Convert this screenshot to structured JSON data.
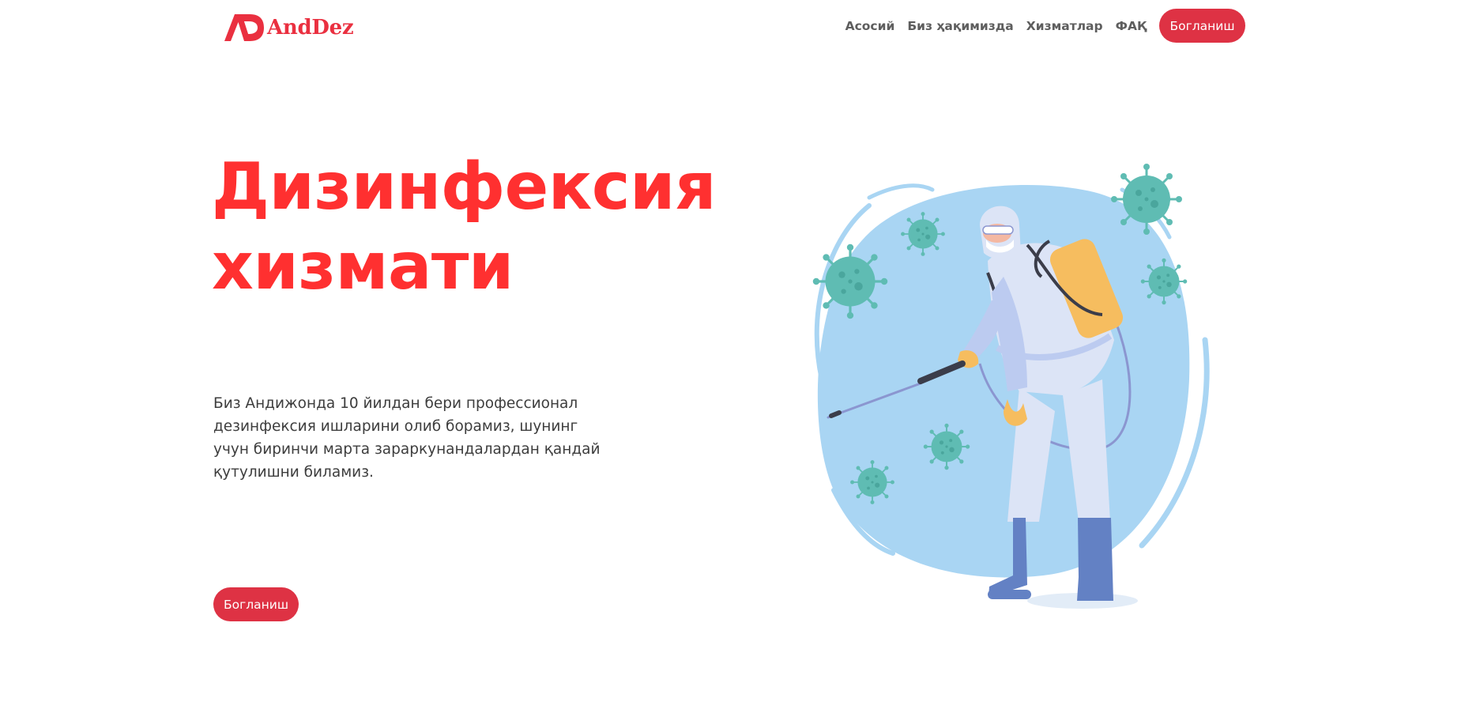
{
  "header": {
    "logo_text": "AndDez",
    "nav": [
      {
        "label": "Асосий"
      },
      {
        "label": "Биз ҳақимизда"
      },
      {
        "label": "Хизматлар"
      },
      {
        "label": "ФАҚ"
      }
    ],
    "cta_label": "Богланиш"
  },
  "hero": {
    "title_line1": "Дизинфексия",
    "title_line2": "хизмати",
    "description": "Биз Андижонда 10 йилдан бери профессионал дезинфексия ишларини олиб борамиз, шунинг учун биринчи марта зараркунандалардан қандай қутулишни биламиз.",
    "cta_label": "Богланиш"
  },
  "colors": {
    "brand_red": "#ff3030",
    "button_red": "#de3244",
    "illustration_blue": "#a9d5f3",
    "virus_teal": "#5fbcb3",
    "tank_yellow": "#f6bd5f",
    "boot_blue": "#6381c4"
  },
  "illustration": {
    "icon": "disinfection-worker-illustration"
  }
}
